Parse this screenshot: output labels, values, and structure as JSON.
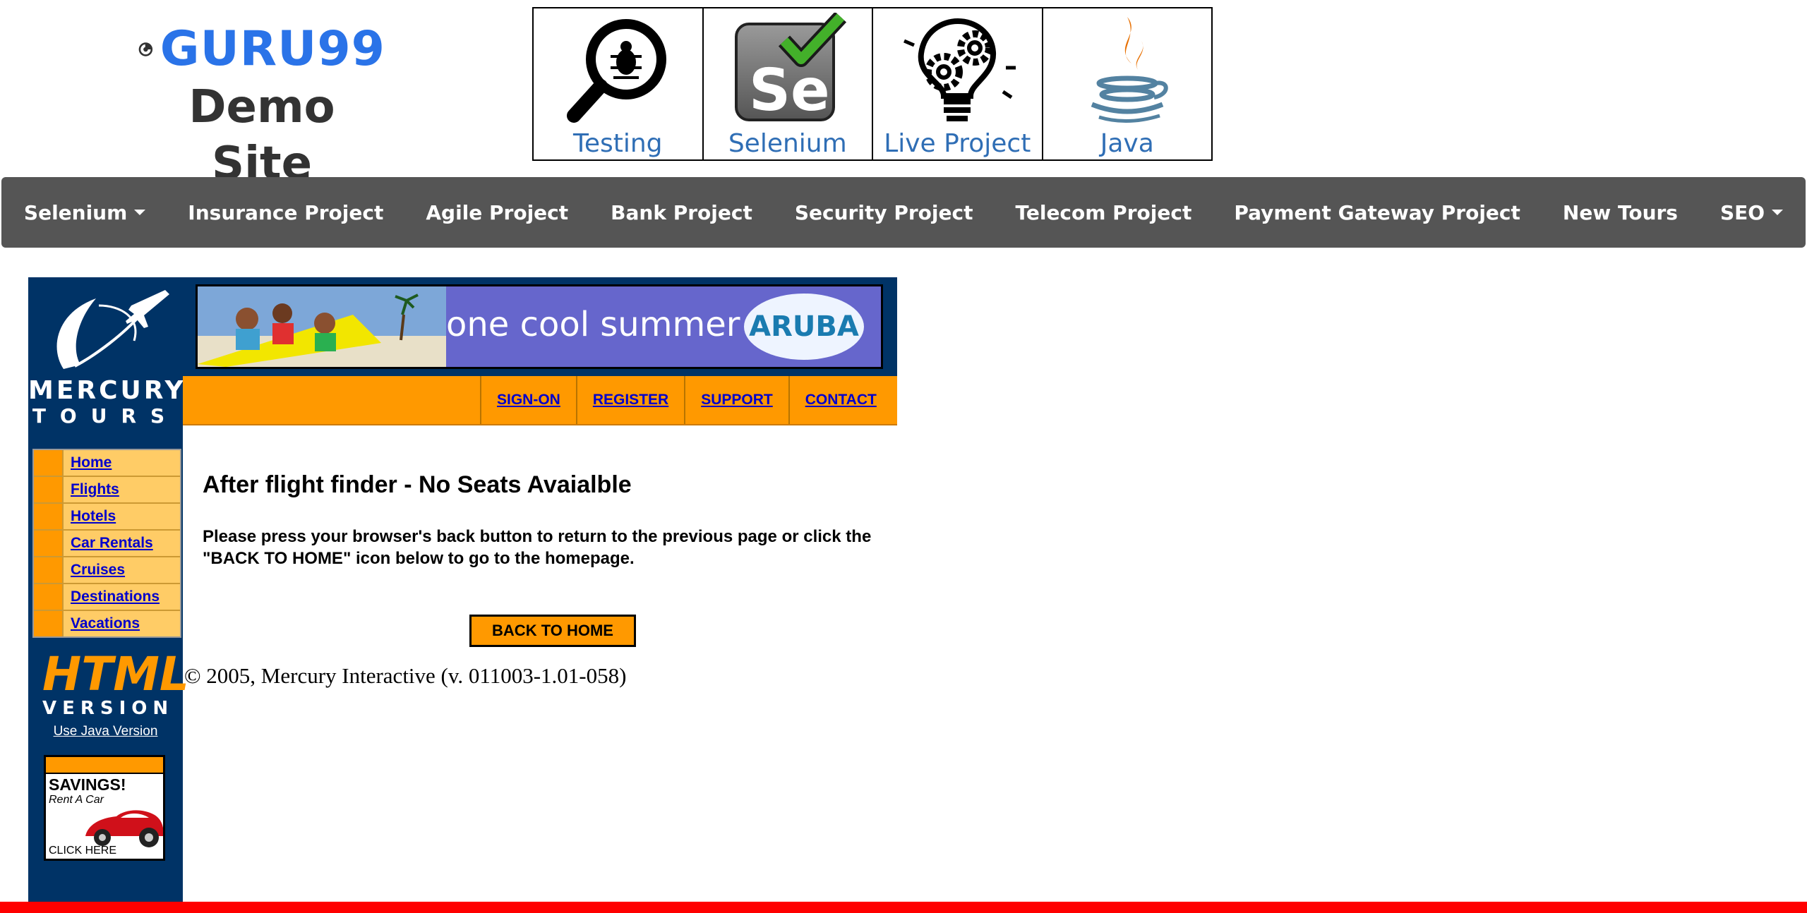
{
  "brand": {
    "name": "GURU99",
    "subtitle": "Demo Site"
  },
  "categories": [
    {
      "label": "Testing",
      "icon": "magnifier-bug-icon"
    },
    {
      "label": "Selenium",
      "icon": "selenium-logo-icon"
    },
    {
      "label": "Live Project",
      "icon": "lightbulb-gear-icon"
    },
    {
      "label": "Java",
      "icon": "java-cup-icon"
    }
  ],
  "navbar": {
    "items": [
      {
        "label": "Selenium",
        "dropdown": true
      },
      {
        "label": "Insurance Project"
      },
      {
        "label": "Agile Project"
      },
      {
        "label": "Bank Project"
      },
      {
        "label": "Security Project"
      },
      {
        "label": "Telecom Project"
      },
      {
        "label": "Payment Gateway Project"
      },
      {
        "label": "New Tours"
      },
      {
        "label": "SEO",
        "dropdown": true
      }
    ]
  },
  "mercury": {
    "logo_line1": "MERCURY",
    "logo_line2": "TOURS",
    "banner_text": "one cool summer",
    "banner_badge": "ARUBA",
    "top_links": [
      "SIGN-ON",
      "REGISTER",
      "SUPPORT",
      "CONTACT"
    ],
    "side_links": [
      "Home",
      "Flights",
      "Hotels",
      "Car Rentals",
      "Cruises",
      "Destinations",
      "Vacations"
    ],
    "html_badge_big": "HTML",
    "html_badge_small": "VERSION",
    "java_link": "Use Java Version",
    "ad": {
      "line1": "SAVINGS!",
      "line2": "Rent A Car",
      "line3": "CLICK HERE"
    }
  },
  "content": {
    "heading": "After flight finder - No Seats Avaialble",
    "message": "Please press your browser's back button to return to the previous page or click the \"BACK TO HOME\" icon below to go to the homepage.",
    "back_button": "BACK TO HOME",
    "copyright": "© 2005, Mercury Interactive (v. 011003-1.01-058)"
  },
  "colors": {
    "brand_blue": "#2a73e8",
    "navbar_bg": "#555555",
    "mercury_navy": "#003366",
    "mercury_orange": "#ff9900",
    "footer_red": "#ff0000"
  }
}
